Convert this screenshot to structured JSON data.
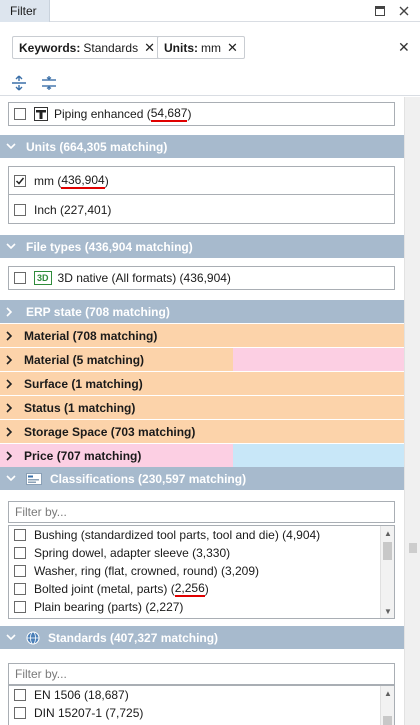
{
  "window": {
    "title": "Filter"
  },
  "active_filters": [
    {
      "label": "Keywords:",
      "value": "Standards"
    },
    {
      "label": "Units:",
      "value": "mm"
    }
  ],
  "piping": {
    "label": "Piping enhanced (",
    "count": "54,687",
    "suffix": ")",
    "checked": false
  },
  "units": {
    "header": "Units (664,305 matching)",
    "items": [
      {
        "label": "mm (",
        "count": "436,904",
        "suffix": ")",
        "checked": true
      },
      {
        "label": "Inch (227,401)",
        "checked": false
      }
    ]
  },
  "file_types": {
    "header": "File types (436,904 matching)",
    "badge": "3D",
    "items": [
      {
        "label": "3D native (All formats) (436,904)",
        "checked": false
      }
    ]
  },
  "erp": {
    "header": "ERP state (708 matching)",
    "rows": [
      {
        "label": "Material (708 matching)"
      },
      {
        "label": "Material (5 matching)"
      },
      {
        "label": "Surface (1 matching)"
      },
      {
        "label": "Status (1 matching)"
      },
      {
        "label": "Storage Space (703 matching)"
      },
      {
        "label": "Price (707 matching)"
      }
    ]
  },
  "classifications": {
    "header": "Classifications (230,597 matching)",
    "filter_placeholder": "Filter by...",
    "items": [
      {
        "label": "Bushing (standardized tool parts, tool and die) (4,904)"
      },
      {
        "label": "Spring dowel, adapter sleeve (3,330)"
      },
      {
        "label": "Washer, ring (flat, crowned, round) (3,209)"
      },
      {
        "label": "Bolted joint (metal, parts) (",
        "count": "2,256",
        "suffix": ")"
      },
      {
        "label": "Plain bearing (parts) (2,227)"
      }
    ]
  },
  "standards": {
    "header": "Standards (407,327 matching)",
    "filter_placeholder": "Filter by...",
    "items": [
      {
        "label": "EN 1506 (18,687)"
      },
      {
        "label": "DIN 15207-1 (7,725)"
      }
    ]
  },
  "colors": {
    "section_header": "#a7bacd",
    "erp_orange": "#fcd3aa",
    "erp_pink": "#fccfe3",
    "erp_blue": "#c8e7f8",
    "highlight_underline": "#e00000"
  }
}
